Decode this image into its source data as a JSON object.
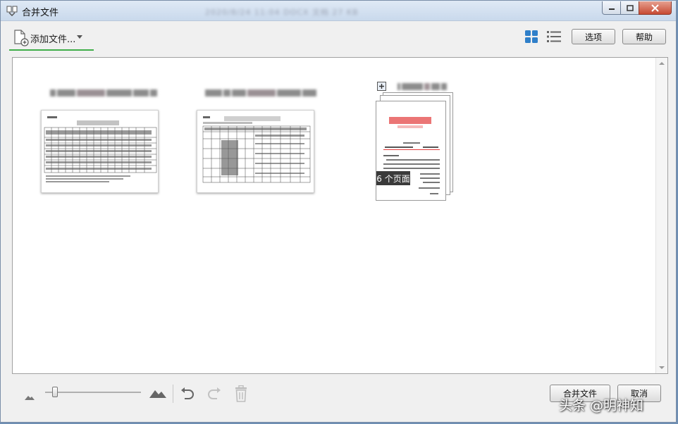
{
  "window": {
    "title": "合并文件",
    "background_blurred_text": "2020/8/24 11:04    DOCX 文档    27 KB"
  },
  "toolbar": {
    "add_file_label": "添加文件...",
    "options_label": "选项",
    "help_label": "帮助",
    "view_grid_icon": "grid-view-icon",
    "view_list_icon": "list-view-icon"
  },
  "files": [
    {
      "type": "spreadsheet",
      "name_blurred": true
    },
    {
      "type": "spreadsheet",
      "name_blurred": true
    },
    {
      "type": "document",
      "name_blurred": true,
      "pages_badge": "6 个页面"
    }
  ],
  "bottom": {
    "zoom_level": 0.1,
    "merge_label": "合并文件",
    "cancel_label": "取消"
  },
  "watermark": "头条 @明神知",
  "colors": {
    "accent_green": "#3fae49",
    "grid_icon_blue": "#2f7fc9",
    "doc_red": "#e23b3b"
  }
}
